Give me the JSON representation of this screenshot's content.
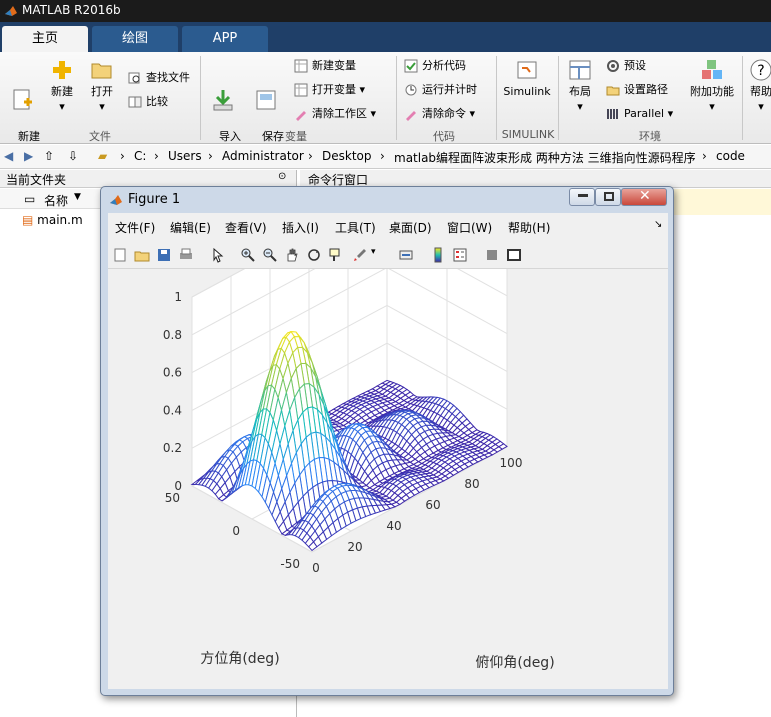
{
  "app": {
    "title": "MATLAB R2016b"
  },
  "tabs": [
    {
      "label": "主页",
      "active": true
    },
    {
      "label": "绘图",
      "active": false
    },
    {
      "label": "APP",
      "active": false
    }
  ],
  "ribbon": {
    "new_script": "新建\n脚本",
    "new": "新建",
    "open": "打开",
    "find_files": "查找文件",
    "compare": "比较",
    "import": "导入\n数据",
    "save_ws": "保存\n工作区",
    "new_var": "新建变量",
    "open_var": "打开变量",
    "clear_ws": "清除工作区",
    "analyze": "分析代码",
    "run_time": "运行并计时",
    "clear_cmd": "清除命令",
    "simulink": "Simulink",
    "layout": "布局",
    "prefs": "预设",
    "set_path": "设置路径",
    "parallel": "Parallel",
    "addons": "附加功能",
    "help": "帮助",
    "groups": {
      "file": "文件",
      "var": "变量",
      "code": "代码",
      "simulink": "SIMULINK",
      "env": "环境"
    }
  },
  "path": [
    "C:",
    "Users",
    "Administrator",
    "Desktop",
    "matlab编程面阵波束形成 两种方法 三维指向性源码程序",
    "code"
  ],
  "panels": {
    "current_folder": "当前文件夹",
    "command_window": "命令行窗口",
    "name_col": "名称",
    "file": "main.m"
  },
  "figure": {
    "title": "Figure 1",
    "menu": [
      "文件(F)",
      "编辑(E)",
      "查看(V)",
      "插入(I)",
      "工具(T)",
      "桌面(D)",
      "窗口(W)",
      "帮助(H)"
    ]
  },
  "chart_data": {
    "type": "surface",
    "title": "",
    "xlabel": "俯仰角(deg)",
    "ylabel": "方位角(deg)",
    "zlabel": "",
    "xlim": [
      0,
      100
    ],
    "ylim": [
      -50,
      50
    ],
    "zlim": [
      0,
      1
    ],
    "x_ticks": [
      "0",
      "20",
      "40",
      "60",
      "80",
      "100"
    ],
    "y_ticks": [
      "-50",
      "0",
      "50"
    ],
    "z_ticks": [
      "0",
      "0.2",
      "0.4",
      "0.6",
      "0.8",
      "1"
    ],
    "peak": {
      "x": 20,
      "y": 0,
      "z": 0.88
    },
    "colormap": "parula",
    "grid": true
  }
}
